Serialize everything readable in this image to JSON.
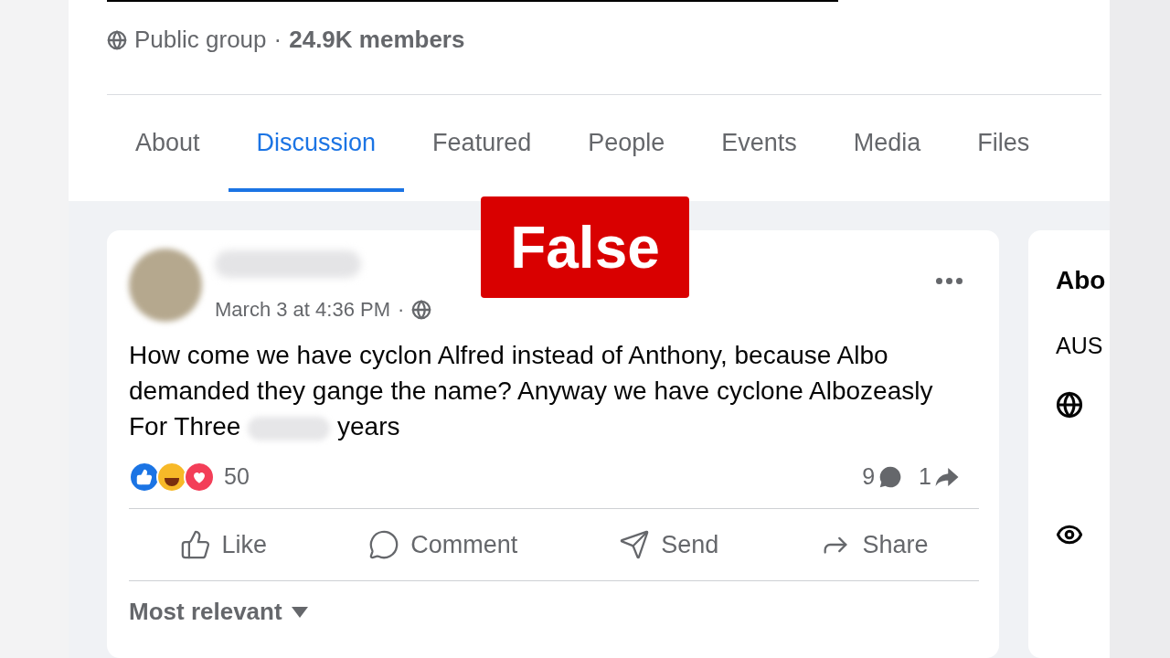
{
  "group": {
    "privacy": "Public group",
    "separator": "·",
    "members": "24.9K members"
  },
  "tabs": [
    {
      "label": "About",
      "selected": false
    },
    {
      "label": "Discussion",
      "selected": true
    },
    {
      "label": "Featured",
      "selected": false
    },
    {
      "label": "People",
      "selected": false
    },
    {
      "label": "Events",
      "selected": false
    },
    {
      "label": "Media",
      "selected": false
    },
    {
      "label": "Files",
      "selected": false
    }
  ],
  "label": "False",
  "post": {
    "time": "March 3 at 4:36 PM",
    "separator": "·",
    "text_before": "How come we have cyclon Alfred instead of Anthony, because Albo demanded they gange the name? Anyway we have cyclone Albozeasly For Three",
    "text_after": "years",
    "reaction_count": "50",
    "comments": "9",
    "shares": "1",
    "actions": [
      {
        "kind": "like",
        "label": "Like"
      },
      {
        "kind": "comment",
        "label": "Comment"
      },
      {
        "kind": "send",
        "label": "Send"
      },
      {
        "kind": "share",
        "label": "Share"
      }
    ],
    "sort": "Most relevant"
  },
  "side_card": {
    "title": "Abo",
    "line": "AUS"
  }
}
